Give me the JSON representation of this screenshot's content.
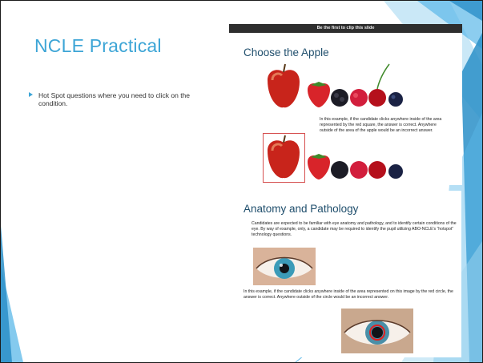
{
  "slide": {
    "title": "NCLE Practical",
    "bullets": [
      "Hot Spot questions where you need to click on the condition."
    ]
  },
  "panel1": {
    "clip_bar": "Be the first to clip this slide",
    "title": "Choose the Apple",
    "caption": "In this example, if the candidate clicks anywhere inside of the area represented by the red square, the answer is correct. Anywhere outside of the area of the apple would be an incorrect answer."
  },
  "panel2": {
    "title": "Anatomy and Pathology",
    "text1": "Candidates are expected to be familiar with eye anatomy and pathology, and to identify certain conditions of the eye. By way of example, only, a candidate may be required to identify the pupil utilizing ABO-NCLE's “hotspot” technology questions.",
    "text2": "In this example, if the candidate clicks anywhere inside of the area represented on this image by the red circle, the answer is correct. Anywhere outside of the circle would be an incorrect answer."
  },
  "colors": {
    "title_accent": "#3da5d6",
    "panel_title": "#1f4e6c",
    "hotspot_red": "#d65050",
    "deco_blue": "#5bb8e8"
  },
  "icons": [
    "bullet-arrow-icon",
    "apple-icon",
    "strawberry-icon",
    "blackberry-icon",
    "raspberry-icon",
    "cherry-icon",
    "blueberry-icon",
    "eye-icon"
  ]
}
